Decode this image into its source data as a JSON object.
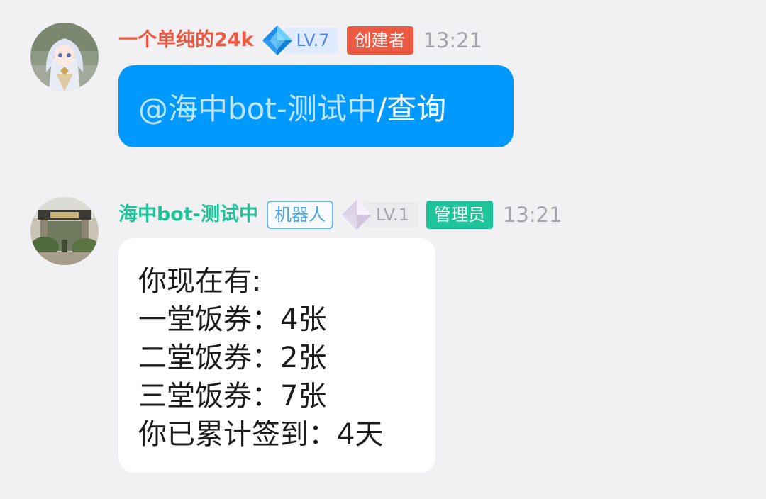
{
  "messages": [
    {
      "nickname": "一个单纯的24k",
      "level": "LV.7",
      "role": "创建者",
      "time": "13:21",
      "content": {
        "mention": "@海中bot-测试中",
        "command": " /查询"
      }
    },
    {
      "nickname": "海中bot-测试中",
      "tag": "机器人",
      "level": "LV.1",
      "role": "管理员",
      "time": "13:21",
      "lines": [
        "你现在有:",
        "一堂饭券：4张",
        "二堂饭券：2张",
        "三堂饭券：7张",
        "你已累计签到：4天"
      ]
    }
  ],
  "colors": {
    "owner_name": "#ec5a44",
    "bot_name": "#1fc49b",
    "self_bubble": "#0099ff",
    "background": "#f1f1f3"
  },
  "icons": {
    "level7": "blue-diamond-icon",
    "level1": "gray-diamond-icon"
  }
}
